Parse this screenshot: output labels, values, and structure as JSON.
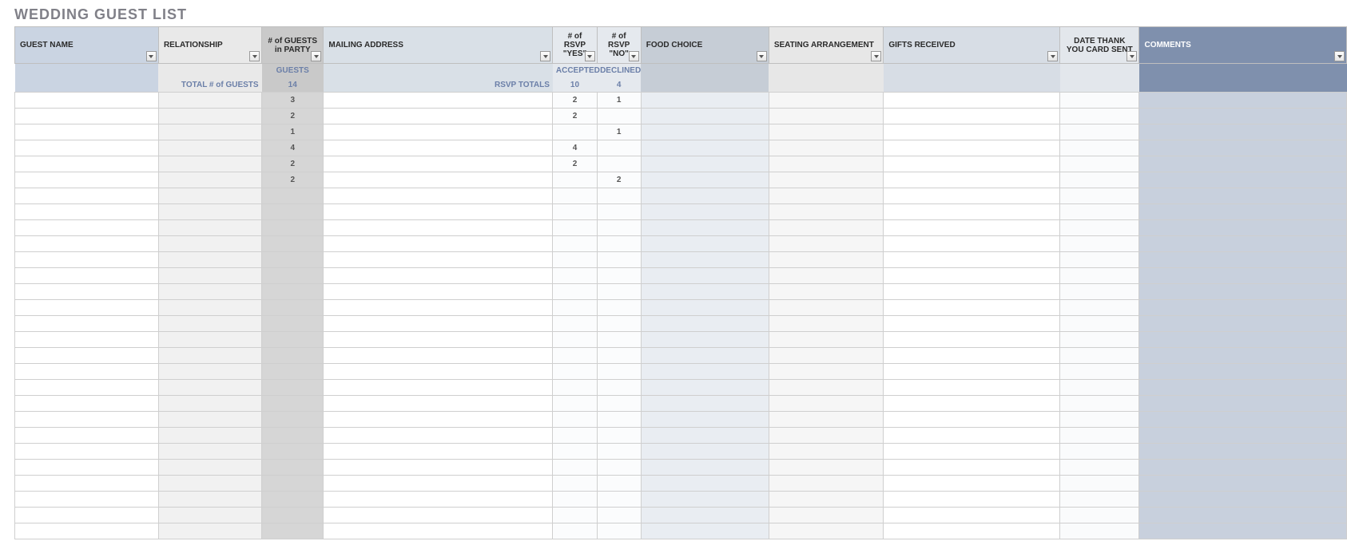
{
  "title": "WEDDING GUEST LIST",
  "summary": {
    "guests_header": "GUESTS",
    "total_label": "TOTAL # of GUESTS",
    "total_value": "14",
    "rsvp_label": "RSVP TOTALS",
    "accepted_header": "ACCEPTED",
    "accepted_value": "10",
    "declined_header": "DECLINED",
    "declined_value": "4"
  },
  "headers": {
    "guest_name": "GUEST NAME",
    "relationship": "RELATIONSHIP",
    "party": "# of GUESTS in PARTY",
    "mailing": "MAILING ADDRESS",
    "rsvp_yes": "# of RSVP \"YES\"",
    "rsvp_no": "# of RSVP \"NO\"",
    "food": "FOOD CHOICE",
    "seating": "SEATING ARRANGEMENT",
    "gifts": "GIFTS RECEIVED",
    "thank": "DATE THANK YOU CARD SENT",
    "comments": "COMMENTS"
  },
  "rows": [
    {
      "guest_name": "",
      "relationship": "",
      "party": "3",
      "mailing": "",
      "yes": "2",
      "no": "1",
      "food": "",
      "seating": "",
      "gifts": "",
      "thank": "",
      "comments": ""
    },
    {
      "guest_name": "",
      "relationship": "",
      "party": "2",
      "mailing": "",
      "yes": "2",
      "no": "",
      "food": "",
      "seating": "",
      "gifts": "",
      "thank": "",
      "comments": ""
    },
    {
      "guest_name": "",
      "relationship": "",
      "party": "1",
      "mailing": "",
      "yes": "",
      "no": "1",
      "food": "",
      "seating": "",
      "gifts": "",
      "thank": "",
      "comments": ""
    },
    {
      "guest_name": "",
      "relationship": "",
      "party": "4",
      "mailing": "",
      "yes": "4",
      "no": "",
      "food": "",
      "seating": "",
      "gifts": "",
      "thank": "",
      "comments": ""
    },
    {
      "guest_name": "",
      "relationship": "",
      "party": "2",
      "mailing": "",
      "yes": "2",
      "no": "",
      "food": "",
      "seating": "",
      "gifts": "",
      "thank": "",
      "comments": ""
    },
    {
      "guest_name": "",
      "relationship": "",
      "party": "2",
      "mailing": "",
      "yes": "",
      "no": "2",
      "food": "",
      "seating": "",
      "gifts": "",
      "thank": "",
      "comments": ""
    },
    {
      "guest_name": "",
      "relationship": "",
      "party": "",
      "mailing": "",
      "yes": "",
      "no": "",
      "food": "",
      "seating": "",
      "gifts": "",
      "thank": "",
      "comments": ""
    },
    {
      "guest_name": "",
      "relationship": "",
      "party": "",
      "mailing": "",
      "yes": "",
      "no": "",
      "food": "",
      "seating": "",
      "gifts": "",
      "thank": "",
      "comments": ""
    },
    {
      "guest_name": "",
      "relationship": "",
      "party": "",
      "mailing": "",
      "yes": "",
      "no": "",
      "food": "",
      "seating": "",
      "gifts": "",
      "thank": "",
      "comments": ""
    },
    {
      "guest_name": "",
      "relationship": "",
      "party": "",
      "mailing": "",
      "yes": "",
      "no": "",
      "food": "",
      "seating": "",
      "gifts": "",
      "thank": "",
      "comments": ""
    },
    {
      "guest_name": "",
      "relationship": "",
      "party": "",
      "mailing": "",
      "yes": "",
      "no": "",
      "food": "",
      "seating": "",
      "gifts": "",
      "thank": "",
      "comments": ""
    },
    {
      "guest_name": "",
      "relationship": "",
      "party": "",
      "mailing": "",
      "yes": "",
      "no": "",
      "food": "",
      "seating": "",
      "gifts": "",
      "thank": "",
      "comments": ""
    },
    {
      "guest_name": "",
      "relationship": "",
      "party": "",
      "mailing": "",
      "yes": "",
      "no": "",
      "food": "",
      "seating": "",
      "gifts": "",
      "thank": "",
      "comments": ""
    },
    {
      "guest_name": "",
      "relationship": "",
      "party": "",
      "mailing": "",
      "yes": "",
      "no": "",
      "food": "",
      "seating": "",
      "gifts": "",
      "thank": "",
      "comments": ""
    },
    {
      "guest_name": "",
      "relationship": "",
      "party": "",
      "mailing": "",
      "yes": "",
      "no": "",
      "food": "",
      "seating": "",
      "gifts": "",
      "thank": "",
      "comments": ""
    },
    {
      "guest_name": "",
      "relationship": "",
      "party": "",
      "mailing": "",
      "yes": "",
      "no": "",
      "food": "",
      "seating": "",
      "gifts": "",
      "thank": "",
      "comments": ""
    },
    {
      "guest_name": "",
      "relationship": "",
      "party": "",
      "mailing": "",
      "yes": "",
      "no": "",
      "food": "",
      "seating": "",
      "gifts": "",
      "thank": "",
      "comments": ""
    },
    {
      "guest_name": "",
      "relationship": "",
      "party": "",
      "mailing": "",
      "yes": "",
      "no": "",
      "food": "",
      "seating": "",
      "gifts": "",
      "thank": "",
      "comments": ""
    },
    {
      "guest_name": "",
      "relationship": "",
      "party": "",
      "mailing": "",
      "yes": "",
      "no": "",
      "food": "",
      "seating": "",
      "gifts": "",
      "thank": "",
      "comments": ""
    },
    {
      "guest_name": "",
      "relationship": "",
      "party": "",
      "mailing": "",
      "yes": "",
      "no": "",
      "food": "",
      "seating": "",
      "gifts": "",
      "thank": "",
      "comments": ""
    },
    {
      "guest_name": "",
      "relationship": "",
      "party": "",
      "mailing": "",
      "yes": "",
      "no": "",
      "food": "",
      "seating": "",
      "gifts": "",
      "thank": "",
      "comments": ""
    },
    {
      "guest_name": "",
      "relationship": "",
      "party": "",
      "mailing": "",
      "yes": "",
      "no": "",
      "food": "",
      "seating": "",
      "gifts": "",
      "thank": "",
      "comments": ""
    },
    {
      "guest_name": "",
      "relationship": "",
      "party": "",
      "mailing": "",
      "yes": "",
      "no": "",
      "food": "",
      "seating": "",
      "gifts": "",
      "thank": "",
      "comments": ""
    },
    {
      "guest_name": "",
      "relationship": "",
      "party": "",
      "mailing": "",
      "yes": "",
      "no": "",
      "food": "",
      "seating": "",
      "gifts": "",
      "thank": "",
      "comments": ""
    },
    {
      "guest_name": "",
      "relationship": "",
      "party": "",
      "mailing": "",
      "yes": "",
      "no": "",
      "food": "",
      "seating": "",
      "gifts": "",
      "thank": "",
      "comments": ""
    },
    {
      "guest_name": "",
      "relationship": "",
      "party": "",
      "mailing": "",
      "yes": "",
      "no": "",
      "food": "",
      "seating": "",
      "gifts": "",
      "thank": "",
      "comments": ""
    },
    {
      "guest_name": "",
      "relationship": "",
      "party": "",
      "mailing": "",
      "yes": "",
      "no": "",
      "food": "",
      "seating": "",
      "gifts": "",
      "thank": "",
      "comments": ""
    },
    {
      "guest_name": "",
      "relationship": "",
      "party": "",
      "mailing": "",
      "yes": "",
      "no": "",
      "food": "",
      "seating": "",
      "gifts": "",
      "thank": "",
      "comments": ""
    }
  ]
}
